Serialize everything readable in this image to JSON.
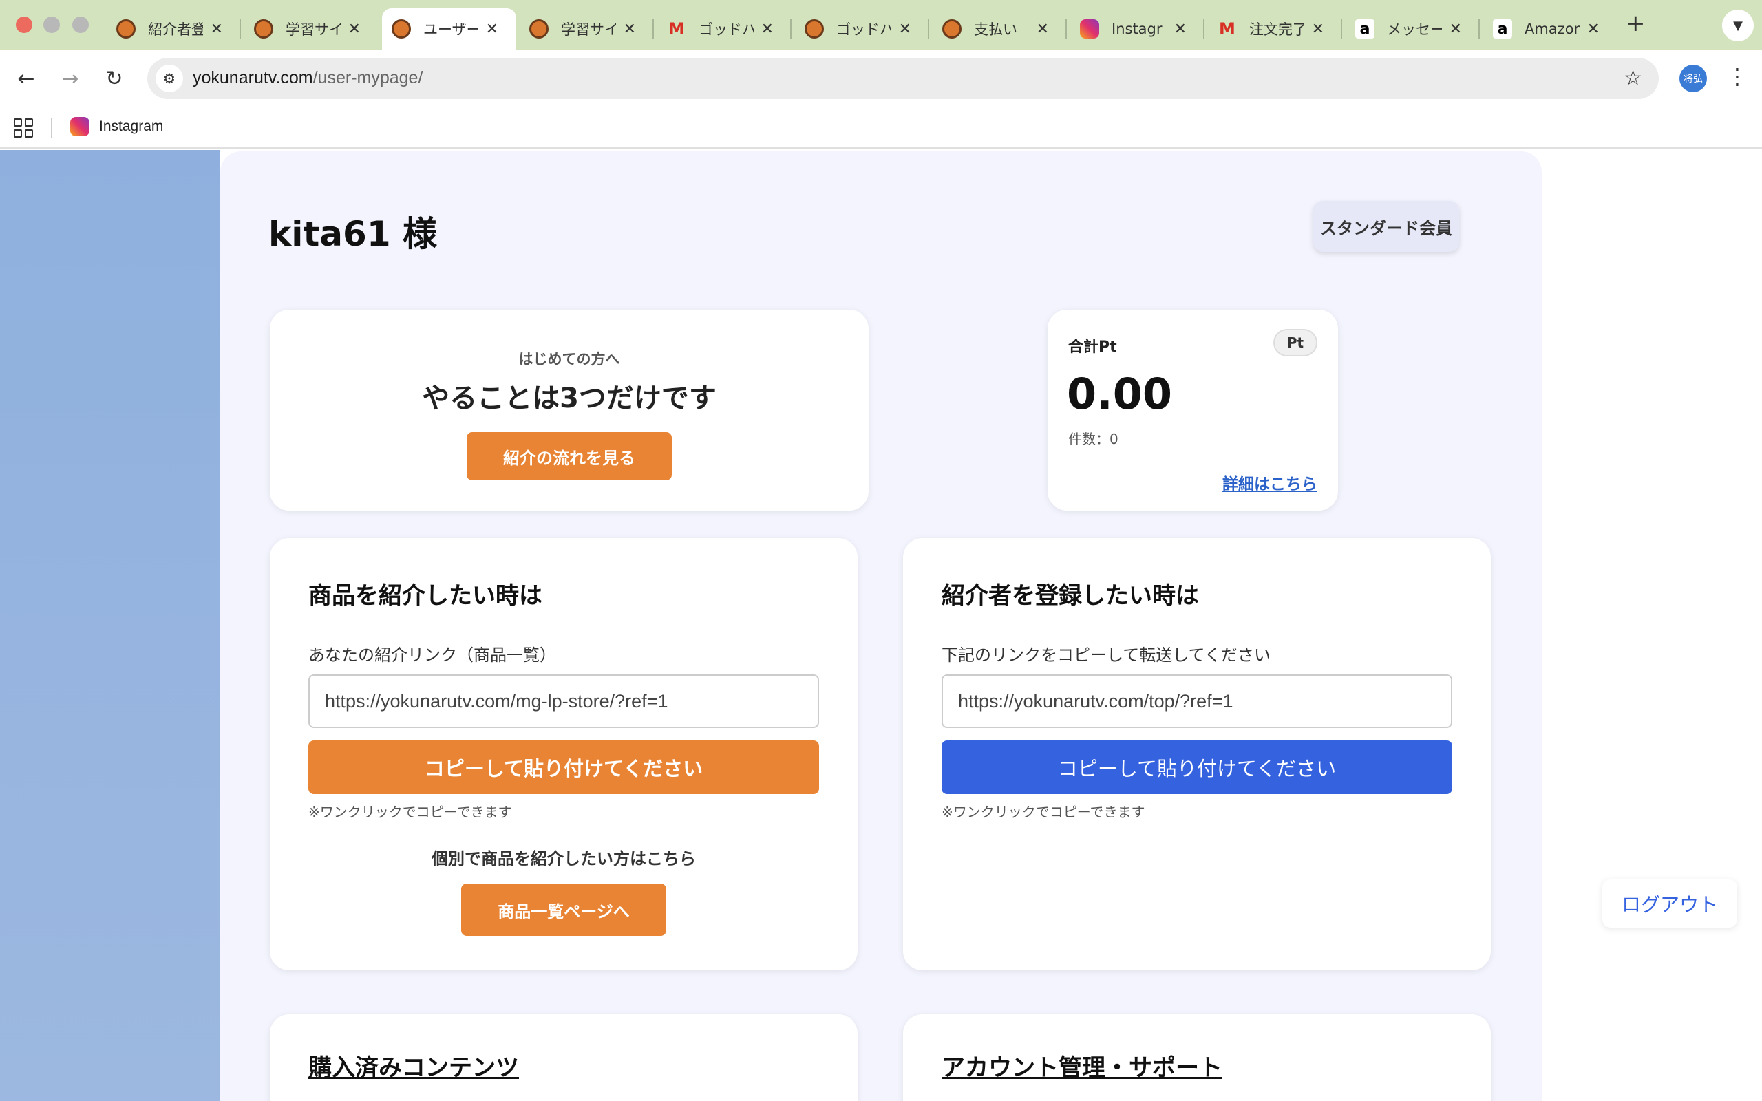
{
  "browser": {
    "tabs": [
      {
        "title": "紹介者登",
        "favicon": "person-avatar"
      },
      {
        "title": "学習サイ",
        "favicon": "person-avatar"
      },
      {
        "title": "ユーザー",
        "favicon": "person-avatar",
        "active": true
      },
      {
        "title": "学習サイ",
        "favicon": "person-avatar"
      },
      {
        "title": "ゴッドハ",
        "favicon": "gmail"
      },
      {
        "title": "ゴッドハ",
        "favicon": "person-avatar"
      },
      {
        "title": "支払い",
        "favicon": "person-avatar"
      },
      {
        "title": "Instagr",
        "favicon": "instagram"
      },
      {
        "title": "注文完了",
        "favicon": "gmail"
      },
      {
        "title": "メッセー",
        "favicon": "amazon"
      },
      {
        "title": "Amazon",
        "favicon": "amazon"
      }
    ],
    "address": {
      "host": "yokunarutv.com",
      "path": "/user-mypage/"
    },
    "profile_initials": "将弘",
    "bookmarks": [
      {
        "label": "Instagram",
        "favicon": "instagram"
      }
    ]
  },
  "page": {
    "user_name": "kita61 様",
    "membership": "スタンダード会員",
    "intro": {
      "subtitle": "はじめての方へ",
      "title": "やることは3つだけです",
      "button": "紹介の流れを見る"
    },
    "points": {
      "label": "合計Pt",
      "chip": "Pt",
      "value": "0.00",
      "count": "件数：0",
      "details_link": "詳細はこちら"
    },
    "product_share": {
      "title": "商品を紹介したい時は",
      "label": "あなたの紹介リンク（商品一覧）",
      "link": "https://yokunarutv.com/mg-lp-store/?ref=1",
      "copy_button": "コピーして貼り付けてください",
      "note": "※ワンクリックでコピーできます",
      "individual_text": "個別で商品を紹介したい方はこちら",
      "catalog_button": "商品一覧ページへ"
    },
    "referrer_share": {
      "title": "紹介者を登録したい時は",
      "label": "下記のリンクをコピーして転送してください",
      "link": "https://yokunarutv.com/top/?ref=1",
      "copy_button": "コピーして貼り付けてください",
      "note": "※ワンクリックでコピーできます"
    },
    "purchased_title": "購入済みコンテンツ",
    "account_title": "アカウント管理・サポート",
    "logout": "ログアウト"
  },
  "colors": {
    "accent_orange": "#e88433",
    "accent_blue": "#3563e0",
    "tab_strip": "#d3e3bd"
  }
}
